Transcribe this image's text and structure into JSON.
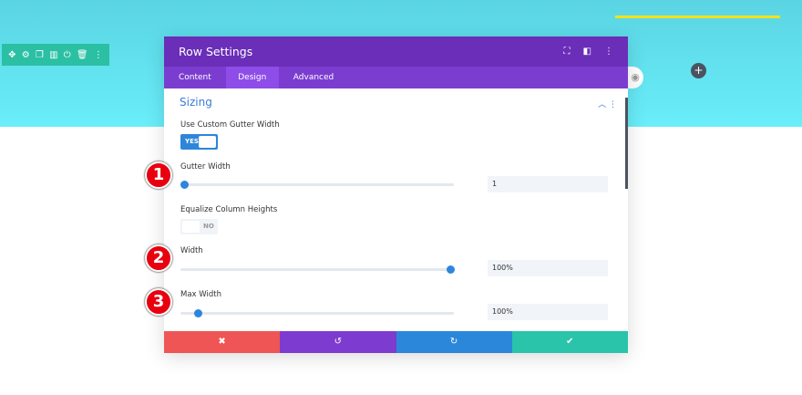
{
  "builder": {
    "row_icons": [
      "move-icon",
      "gear-icon",
      "duplicate-icon",
      "columns-icon",
      "power-icon",
      "trash-icon",
      "more-icon"
    ],
    "add_label": "+"
  },
  "modal": {
    "title": "Row Settings",
    "tabs": [
      "Content",
      "Design",
      "Advanced"
    ],
    "active_tab": "Design"
  },
  "section": {
    "title": "Sizing"
  },
  "fields": {
    "custom_gutter": {
      "label": "Use Custom Gutter Width",
      "value": "YES"
    },
    "gutter_width": {
      "label": "Gutter Width",
      "value": "1",
      "slider_fraction": 0.0
    },
    "equalize": {
      "label": "Equalize Column Heights",
      "value": "NO"
    },
    "width": {
      "label": "Width",
      "value": "100%",
      "slider_fraction": 1.0
    },
    "max_width": {
      "label": "Max Width",
      "value": "100%",
      "slider_fraction": 0.05
    }
  },
  "footer": {
    "cancel": "✖",
    "undo": "↺",
    "redo": "↻",
    "save": "✔"
  },
  "badges": [
    "1",
    "2",
    "3"
  ],
  "colors": {
    "header": "#6a2eb8",
    "tabs": "#7b3dd0",
    "accent": "#2d86da",
    "cancel": "#ef5555",
    "undo": "#7e3bd0",
    "redo": "#2b87da",
    "save": "#29c4a9"
  }
}
